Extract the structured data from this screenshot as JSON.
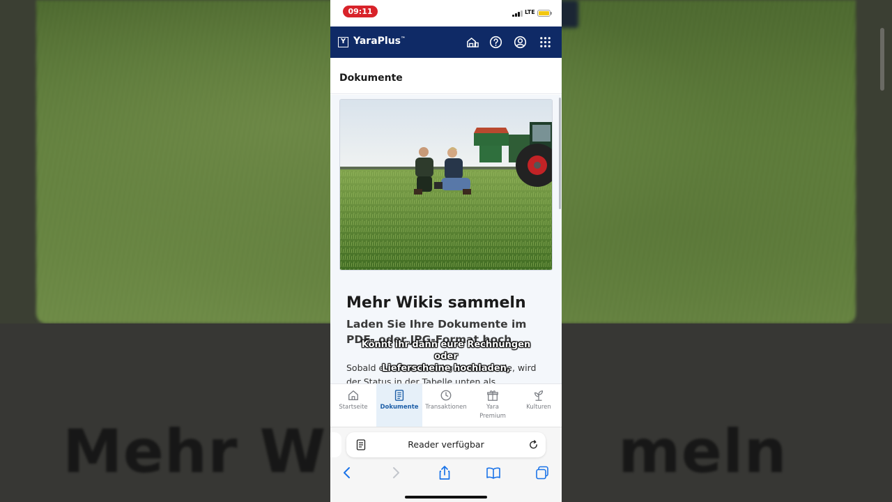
{
  "background": {
    "heading_fragment_left": "Mehr Wik",
    "heading_fragment_right": "meln"
  },
  "status_bar": {
    "time": "09:11",
    "network": "LTE"
  },
  "header": {
    "brand": "YaraPlus",
    "trademark": "™",
    "logo_letter": "Y",
    "icons": [
      "farm-icon",
      "help-icon",
      "account-icon",
      "apps-grid-icon"
    ]
  },
  "page": {
    "title": "Dokumente"
  },
  "article": {
    "heading": "Mehr Wikis sammeln",
    "subheading": "Laden Sie Ihre Dokumente im PDF- oder JPG-Format hoch.",
    "body": "Sobald eine Datei hochgeladen wurde, wird der Status in der Tabelle unten als \"Ausstehend\""
  },
  "subtitles": {
    "line1": "Könnt ihr dann eure Rechnungen",
    "line2": "oder",
    "line3": "Lieferscheine hochladen,"
  },
  "tabs": [
    {
      "label": "Startseite",
      "icon": "home-icon",
      "active": false
    },
    {
      "label": "Dokumente",
      "icon": "document-icon",
      "active": true
    },
    {
      "label": "Transaktionen",
      "icon": "clock-icon",
      "active": false
    },
    {
      "label": "Yara Premium",
      "icon": "gift-icon",
      "active": false
    },
    {
      "label": "Kulturen",
      "icon": "plant-icon",
      "active": false
    }
  ],
  "browser": {
    "url_text": "Reader verfügbar"
  },
  "colors": {
    "brand_navy": "#0f2a66",
    "active_tab": "#1e5fa8",
    "time_pill": "#d8232a"
  }
}
